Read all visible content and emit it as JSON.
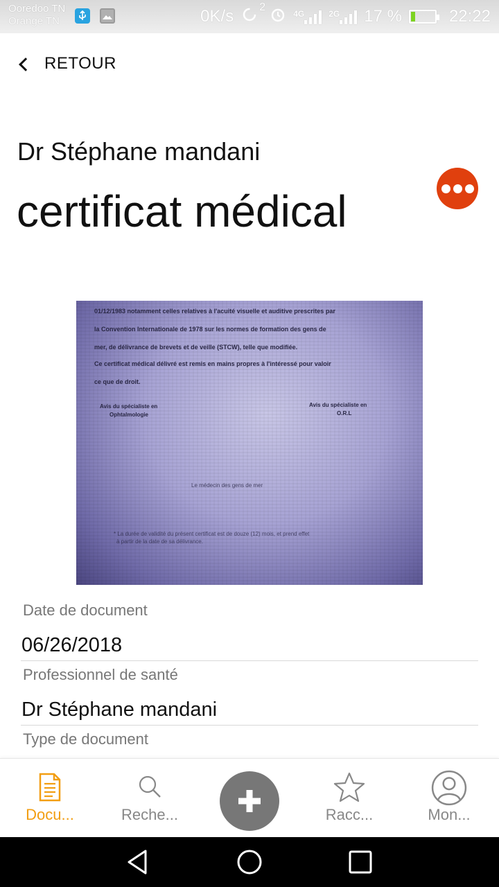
{
  "status_bar": {
    "carrier_1": "Ooredoo TN",
    "carrier_2": "Orange TN",
    "speed": "0K/s",
    "sim_badge": "2",
    "net_1": "4G",
    "net_2": "2G",
    "battery": "17 %",
    "battery_level": 0.17,
    "time": "22:22",
    "icons": [
      "usb-icon",
      "gallery-icon",
      "sync-icon",
      "alarm-icon",
      "signal-icon",
      "battery-icon"
    ]
  },
  "header": {
    "back_label": "RETOUR",
    "doctor_name": "Dr Stéphane mandani",
    "title": "certificat médical"
  },
  "colors": {
    "accent": "#e0400e",
    "active_tab": "#f29e12",
    "fab": "#777777"
  },
  "document_image": {
    "lines": [
      "01/12/1983 notamment celles relatives à l'acuité visuelle et auditive prescrites par",
      "la Convention Internationale de 1978 sur les normes de formation des gens de",
      "mer, de délivrance de brevets et de veille (STCW), telle que modifiée.",
      "Ce certificat médical délivré est remis en mains propres à l'intéressé pour valoir",
      "ce que de droit."
    ],
    "left_sign": "Avis du spécialiste en",
    "left_sign_2": "Ophtalmologie",
    "right_sign": "Avis du spécialiste en",
    "right_sign_2": "O.R.L",
    "center_sign": "Le médecin des gens de mer",
    "footnote_1": "* La durée de validité du présent certificat est de douze (12) mois, et prend effet",
    "footnote_2": "à partir de la date de sa délivrance."
  },
  "fields": [
    {
      "label": "Date de  document",
      "value": "06/26/2018"
    },
    {
      "label": "Professionnel de  santé",
      "value": "Dr Stéphane mandani"
    },
    {
      "label": "Type  de document",
      "value": ""
    }
  ],
  "bottom_nav": {
    "items": [
      {
        "label": "Docu...",
        "icon": "document-icon",
        "active": true
      },
      {
        "label": "Reche...",
        "icon": "search-icon",
        "active": false
      },
      {
        "label": "Racc...",
        "icon": "star-icon",
        "active": false
      },
      {
        "label": "Mon...",
        "icon": "profile-icon",
        "active": false
      }
    ],
    "fab_icon": "plus-icon"
  },
  "system_nav": [
    "back-icon",
    "home-icon",
    "recents-icon"
  ]
}
